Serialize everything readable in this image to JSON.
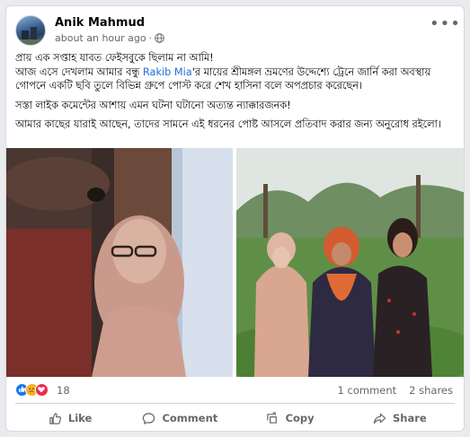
{
  "post": {
    "author": "Anik Mahmud",
    "time": "about an hour ago",
    "time_separator": "·",
    "more_icon": "more-dots-icon",
    "paragraphs": [
      {
        "line1": "প্রায় এক সপ্তাহ যাবত ফেইসবুকে ছিলাম না আমি!",
        "line2_before": "আজ এসে দেখলাম আমার বন্ধু ",
        "mention": "Rakib Mia",
        "line2_after": "'র মায়ের শ্রীমঙ্গল ভ্রমণের উদ্দেশ্যে ট্রেনে জার্নি করা অবস্থায় গোপনে একটি ছবি তুলে বিভিন্ন গ্রুপে পোস্ট করে শেখ হাসিনা বলে অপপ্রচার করেছেন।"
      }
    ],
    "para2": "সস্তা লাইক কমেন্টের আশায় এমন ঘটনা ঘটানো অত্যন্ত ন্যাক্কারজনক!",
    "para3": "আমার কাছের যারাই আছেন, তাদের সামনে এই ধরনের পোষ্ট আসলে প্রতিবাদ করার জন্য অনুরোধ রইলো।"
  },
  "reactions": {
    "count": "18",
    "comments": "1 comment",
    "shares": "2 shares"
  },
  "actions": {
    "like": "Like",
    "comment": "Comment",
    "copy": "Copy",
    "share": "Share"
  }
}
